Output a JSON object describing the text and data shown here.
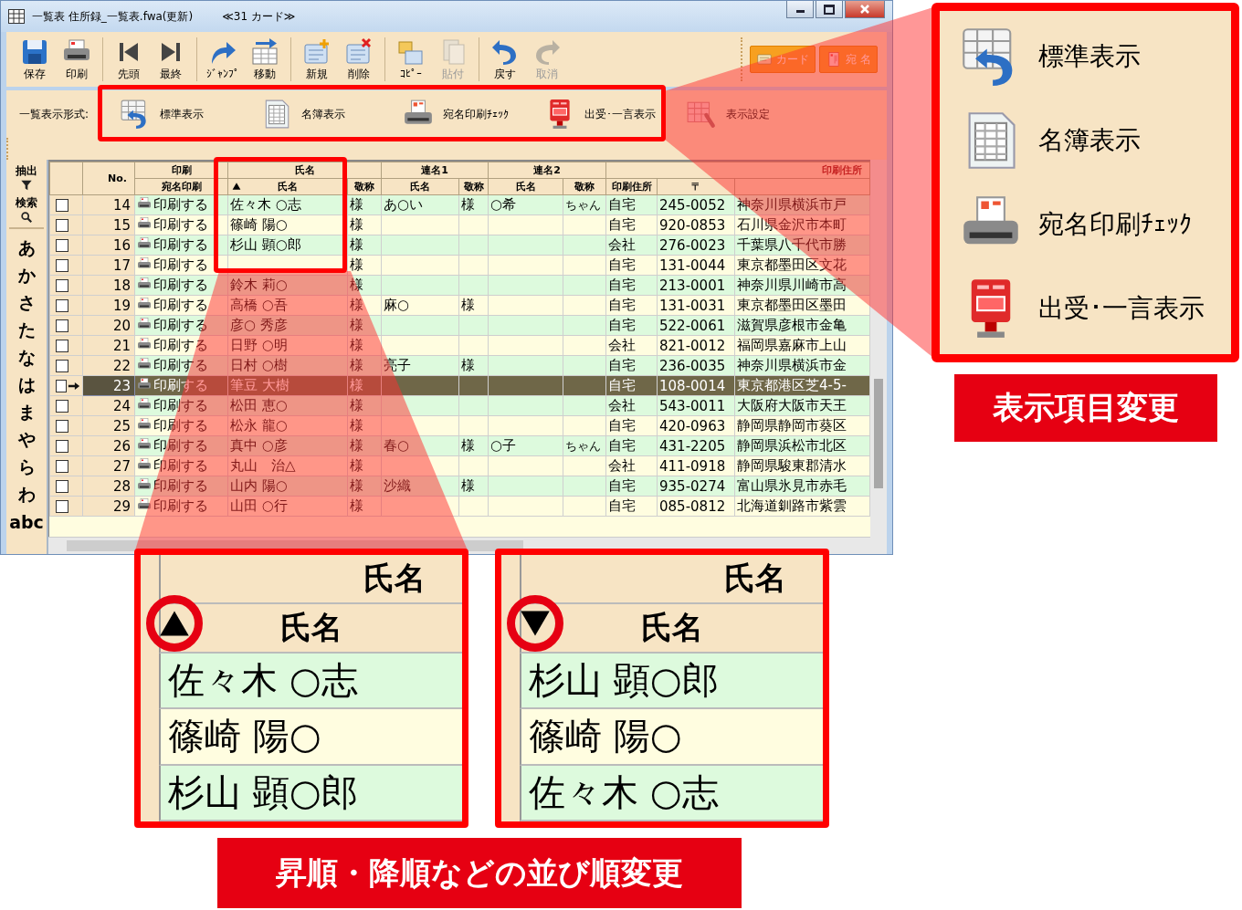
{
  "window": {
    "title": "一覧表 住所録_一覧表.fwa(更新)",
    "card_count": "≪31 カード≫"
  },
  "toolbar": [
    {
      "label": "保存",
      "kind": "save",
      "disabled": false
    },
    {
      "label": "印刷",
      "kind": "print",
      "disabled": false
    },
    {
      "label": "先頭",
      "kind": "first",
      "disabled": false
    },
    {
      "label": "最終",
      "kind": "last",
      "disabled": false
    },
    {
      "label": "ｼﾞｬﾝﾌﾟ",
      "kind": "jump",
      "disabled": false
    },
    {
      "label": "移動",
      "kind": "move",
      "disabled": false
    },
    {
      "label": "新規",
      "kind": "new",
      "disabled": false
    },
    {
      "label": "削除",
      "kind": "delete",
      "disabled": false
    },
    {
      "label": "ｺﾋﾟｰ",
      "kind": "copy",
      "disabled": false
    },
    {
      "label": "貼付",
      "kind": "paste",
      "disabled": true
    },
    {
      "label": "戻す",
      "kind": "undo",
      "disabled": false
    },
    {
      "label": "取消",
      "kind": "redo",
      "disabled": true
    }
  ],
  "mode_buttons": [
    {
      "label": "カード",
      "kind": "card"
    },
    {
      "label": "宛 名",
      "kind": "address"
    }
  ],
  "format_bar": {
    "label": "一覧表示形式:",
    "options": [
      {
        "label": "標準表示",
        "kind": "standard"
      },
      {
        "label": "名簿表示",
        "kind": "roster"
      },
      {
        "label": "宛名印刷ﾁｪｯｸ",
        "kind": "printcheck"
      },
      {
        "label": "出受･一言表示",
        "kind": "postbox"
      }
    ],
    "settings": "表示設定"
  },
  "index_strip": {
    "extract": "抽出",
    "search": "検索",
    "letters": [
      "あ",
      "か",
      "さ",
      "た",
      "な",
      "は",
      "ま",
      "や",
      "ら",
      "わ",
      "abc"
    ]
  },
  "table": {
    "headers": {
      "no": "No.",
      "print_group": "印刷",
      "print": "宛名印刷",
      "name_group": "氏名",
      "name": "氏名",
      "name_sort_ascending": true,
      "honorific": "敬称",
      "joint1_group": "連名1",
      "joint1_name": "氏名",
      "joint1_honorific": "敬称",
      "joint2_group": "連名2",
      "joint2_name": "氏名",
      "joint2_honorific": "敬称",
      "address_group": "印刷住所",
      "address_type": "印刷住所",
      "zip": "〒"
    },
    "rows": [
      {
        "checked": false,
        "selected": false,
        "no": "14",
        "print": "印刷する",
        "name": "佐々木 ○志",
        "honorific": "様",
        "joint1_name": "あ○い",
        "joint1_honorific": "様",
        "joint2_name": "○希",
        "joint2_honorific": "ちゃん",
        "address_type": "自宅",
        "zip": "245-0052",
        "address": "神奈川県横浜市戸"
      },
      {
        "checked": false,
        "selected": false,
        "no": "15",
        "print": "印刷する",
        "name": "篠崎 陽○",
        "honorific": "様",
        "address_type": "自宅",
        "zip": "920-0853",
        "address": "石川県金沢市本町"
      },
      {
        "checked": false,
        "selected": false,
        "no": "16",
        "print": "印刷する",
        "name": "杉山 顕○郎",
        "honorific": "様",
        "address_type": "会社",
        "zip": "276-0023",
        "address": "千葉県八千代市勝"
      },
      {
        "checked": false,
        "selected": false,
        "no": "17",
        "print": "印刷する",
        "honorific": "様",
        "address_type": "自宅",
        "zip": "131-0044",
        "address": "東京都墨田区文花"
      },
      {
        "checked": false,
        "selected": false,
        "no": "18",
        "print": "印刷する",
        "name": "鈴木 莉○",
        "honorific": "様",
        "address_type": "自宅",
        "zip": "213-0001",
        "address": "神奈川県川崎市高"
      },
      {
        "checked": false,
        "selected": false,
        "no": "19",
        "print": "印刷する",
        "name": "高橋 ○吾",
        "honorific": "様",
        "joint1_name": "麻○",
        "joint1_honorific": "様",
        "address_type": "自宅",
        "zip": "131-0031",
        "address": "東京都墨田区墨田"
      },
      {
        "checked": false,
        "selected": false,
        "no": "20",
        "print": "印刷する",
        "name": "彦○ 秀彦",
        "honorific": "様",
        "address_type": "自宅",
        "zip": "522-0061",
        "address": "滋賀県彦根市金亀"
      },
      {
        "checked": false,
        "selected": false,
        "no": "21",
        "print": "印刷する",
        "name": "日野 ○明",
        "honorific": "様",
        "address_type": "会社",
        "zip": "821-0012",
        "address": "福岡県嘉麻市上山"
      },
      {
        "checked": false,
        "selected": false,
        "no": "22",
        "print": "印刷する",
        "name": "日村 ○樹",
        "honorific": "様",
        "joint1_name": "亮子",
        "joint1_honorific": "様",
        "address_type": "自宅",
        "zip": "236-0035",
        "address": "神奈川県横浜市金"
      },
      {
        "checked": false,
        "selected": true,
        "no": "23",
        "print": "印刷する",
        "name": "筆豆 大樹",
        "honorific": "様",
        "address_type": "自宅",
        "zip": "108-0014",
        "address": "東京都港区芝4-5-"
      },
      {
        "checked": false,
        "selected": false,
        "no": "24",
        "print": "印刷する",
        "name": "松田 恵○",
        "honorific": "様",
        "address_type": "会社",
        "zip": "543-0011",
        "address": "大阪府大阪市天王"
      },
      {
        "checked": false,
        "selected": false,
        "no": "25",
        "print": "印刷する",
        "name": "松永 龍○",
        "honorific": "様",
        "address_type": "自宅",
        "zip": "420-0963",
        "address": "静岡県静岡市葵区"
      },
      {
        "checked": false,
        "selected": false,
        "no": "26",
        "print": "印刷する",
        "name": "真中 ○彦",
        "honorific": "様",
        "joint1_name": "春○",
        "joint1_honorific": "様",
        "joint2_name": "○子",
        "joint2_honorific": "ちゃん",
        "address_type": "自宅",
        "zip": "431-2205",
        "address": "静岡県浜松市北区"
      },
      {
        "checked": false,
        "selected": false,
        "no": "27",
        "print": "印刷する",
        "name": "丸山　治△",
        "honorific": "様",
        "address_type": "会社",
        "zip": "411-0918",
        "address": "静岡県駿東郡清水"
      },
      {
        "checked": false,
        "selected": false,
        "no": "28",
        "print": "印刷する",
        "name": "山内 陽○",
        "honorific": "様",
        "joint1_name": "沙織",
        "joint1_honorific": "様",
        "address_type": "自宅",
        "zip": "935-0274",
        "address": "富山県氷見市赤毛"
      },
      {
        "checked": false,
        "selected": false,
        "no": "29",
        "print": "印刷する",
        "name": "山田 ○行",
        "honorific": "様",
        "address_type": "自宅",
        "zip": "085-0812",
        "address": "北海道釧路市紫雲"
      }
    ]
  },
  "callouts": {
    "display_items": {
      "items": [
        {
          "label": "標準表示",
          "kind": "standard"
        },
        {
          "label": "名簿表示",
          "kind": "roster"
        },
        {
          "label": "宛名印刷ﾁｪｯｸ",
          "kind": "printcheck"
        },
        {
          "label": "出受･一言表示",
          "kind": "postbox"
        }
      ],
      "caption": "表示項目変更"
    },
    "sort_order": {
      "panels": [
        {
          "group": "氏名",
          "header": "氏名",
          "sort_ascending": true,
          "names": [
            "佐々木 ○志",
            "篠崎 陽○",
            "杉山 顕○郎"
          ]
        },
        {
          "group": "氏名",
          "header": "氏名",
          "sort_ascending": false,
          "names": [
            "杉山 顕○郎",
            "篠崎 陽○",
            "佐々木 ○志"
          ]
        }
      ],
      "caption": "昇順・降順などの並び順変更"
    }
  }
}
